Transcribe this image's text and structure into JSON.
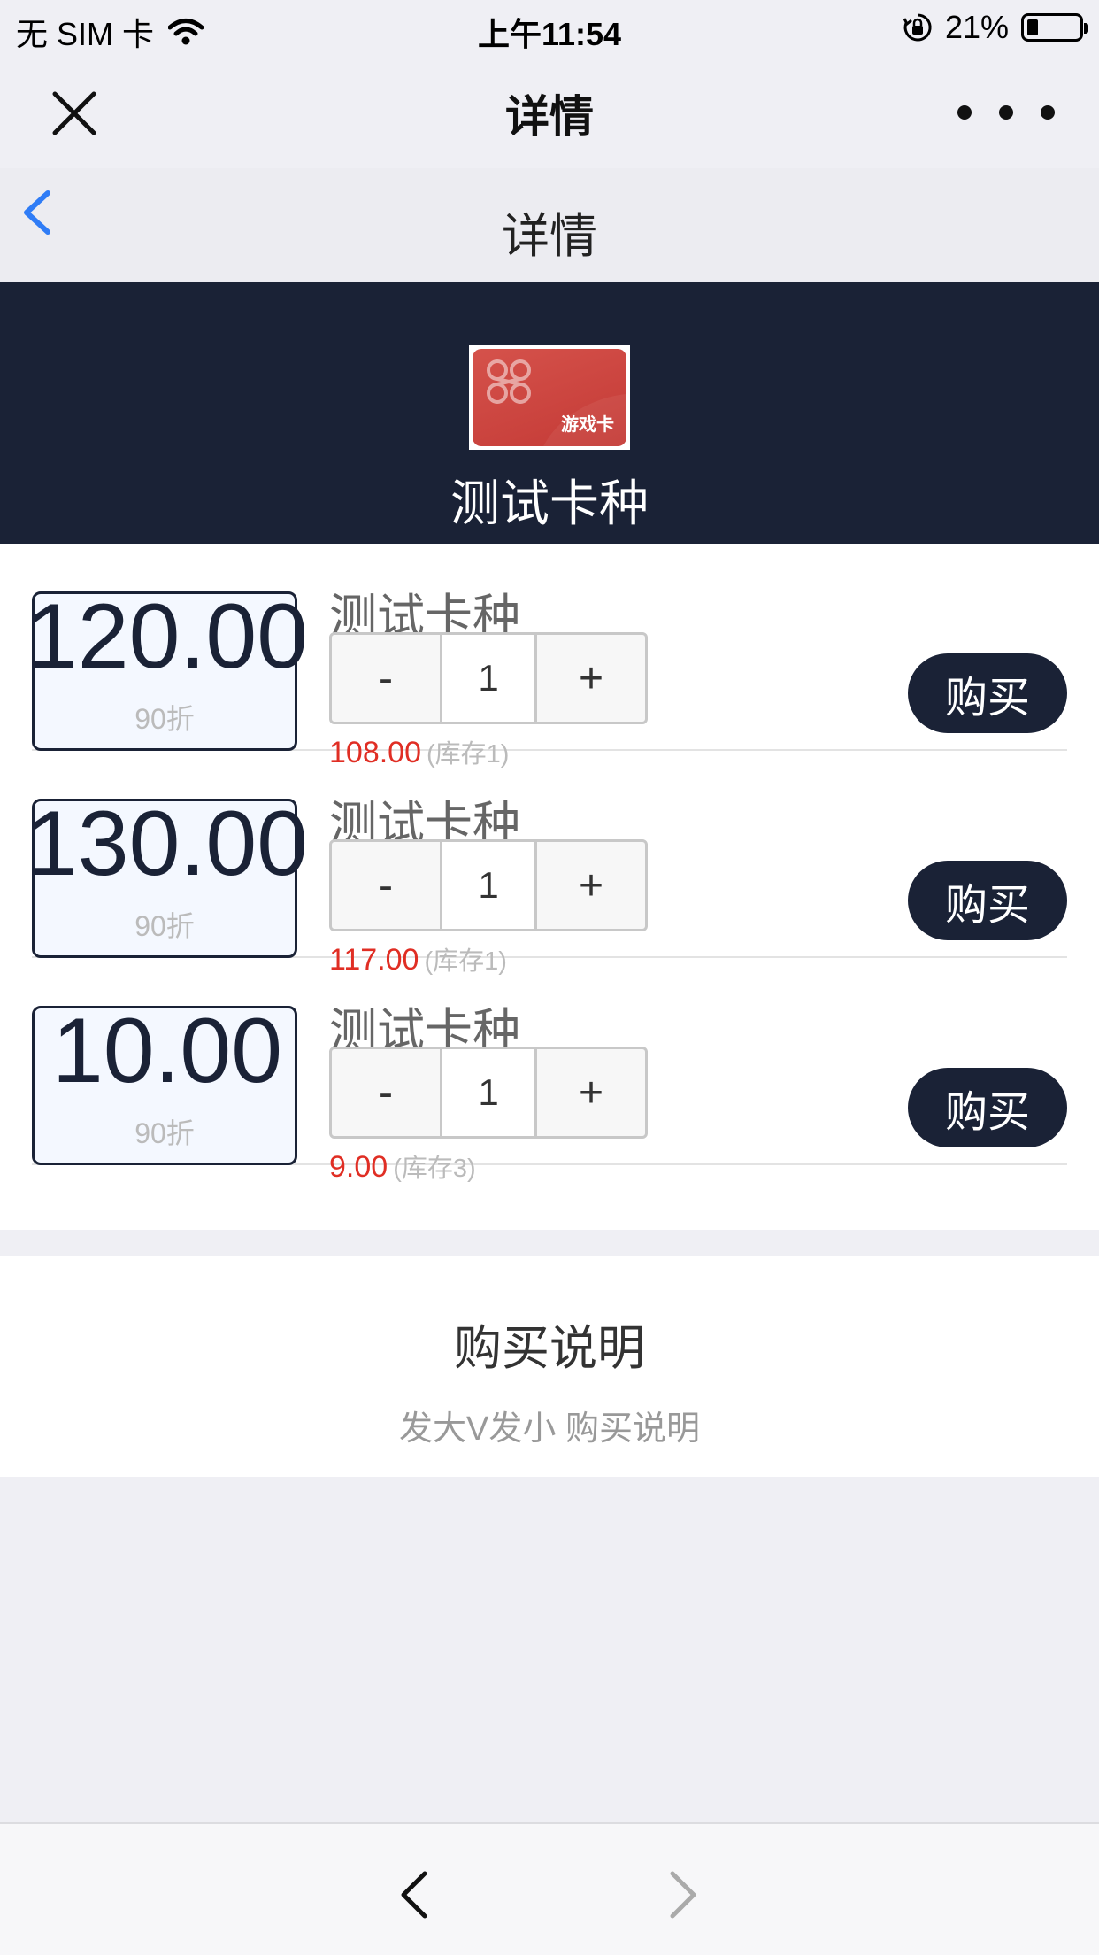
{
  "status_bar": {
    "carrier": "无 SIM 卡",
    "time": "上午11:54",
    "battery_percent": "21%",
    "battery_level": 0.21,
    "icons": [
      "wifi-icon",
      "orientation-lock-icon",
      "battery-icon"
    ]
  },
  "nav": {
    "title": "详情",
    "icons": [
      "close-icon",
      "more-icon"
    ]
  },
  "header": {
    "title": "详情",
    "back_icon": "chevron-left-icon",
    "accent_color": "#2f7cf6"
  },
  "hero": {
    "card_tag": "游戏卡",
    "title": "测试卡种",
    "background_color": "#1a2236"
  },
  "products": [
    {
      "face_value": "120.00",
      "discount": "90折",
      "name": "测试卡种",
      "qty": "1",
      "price": "108.00",
      "stock": "(库存1)",
      "buy_label": "购买"
    },
    {
      "face_value": "130.00",
      "discount": "90折",
      "name": "测试卡种",
      "qty": "1",
      "price": "117.00",
      "stock": "(库存1)",
      "buy_label": "购买"
    },
    {
      "face_value": "10.00",
      "discount": "90折",
      "name": "测试卡种",
      "qty": "1",
      "price": "9.00",
      "stock": "(库存3)",
      "buy_label": "购买"
    }
  ],
  "stepper": {
    "minus_label": "-",
    "plus_label": "+"
  },
  "notes": {
    "title": "购买说明",
    "text": "发大V发小 购买说明"
  },
  "bottom_bar": {
    "icons": [
      "back-arrow-icon",
      "forward-arrow-icon"
    ]
  },
  "colors": {
    "primary": "#1a2236",
    "price": "#e02e24",
    "link": "#2f7cf6"
  }
}
